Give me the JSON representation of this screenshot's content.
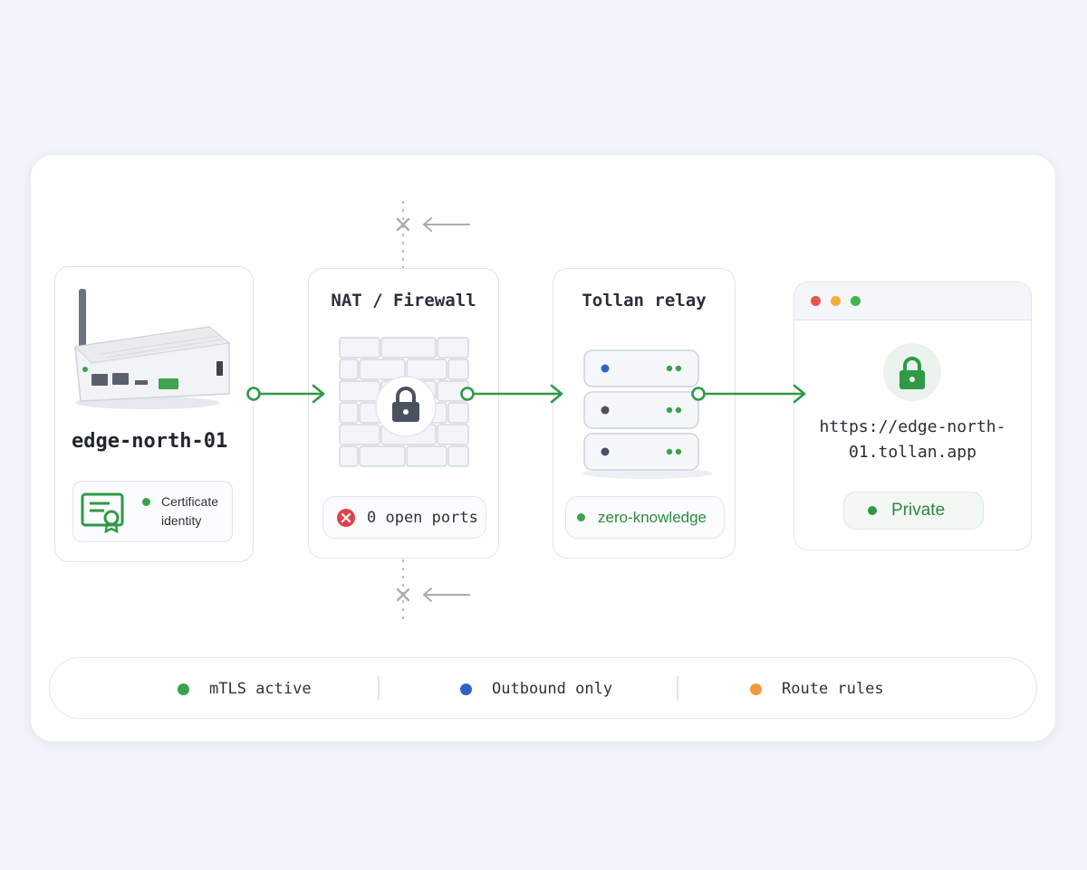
{
  "device": {
    "name": "edge-north-01",
    "cert_line1": "Certificate",
    "cert_line2": "identity"
  },
  "firewall": {
    "title": "NAT / Firewall",
    "badge": "0 open ports"
  },
  "relay": {
    "title": "Tollan relay",
    "badge": "zero-knowledge"
  },
  "browser": {
    "url_line1": "https://edge-north-",
    "url_line2": "01.tollan.app",
    "status": "Private"
  },
  "legend": [
    {
      "label": "mTLS active",
      "color": "#3aa34c"
    },
    {
      "label": "Outbound only",
      "color": "#2f63c9"
    },
    {
      "label": "Route rules",
      "color": "#ef9a3c"
    }
  ],
  "colors": {
    "accent_green": "#2e9a45",
    "blocked_gray": "#a7adb8",
    "error_red": "#e0424d"
  }
}
